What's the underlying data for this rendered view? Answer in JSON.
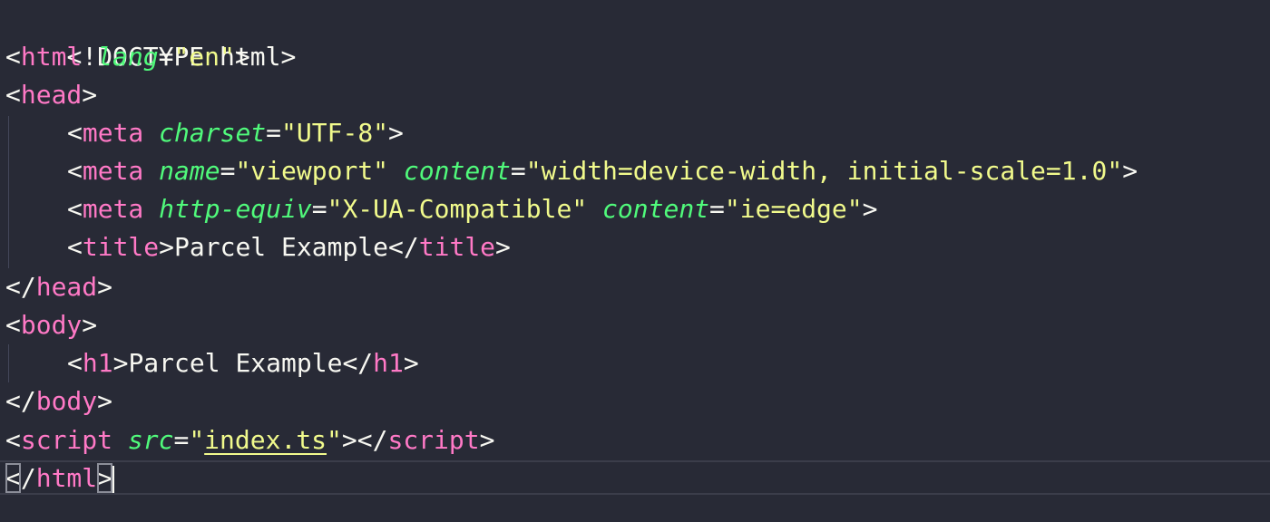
{
  "editor": {
    "lines": [
      {
        "doctype": "<!DOCTYPE html>"
      },
      {
        "open": "<",
        "tag": "html",
        "attr1": "lang",
        "eq": "=",
        "val1": "\"en\"",
        "close": ">"
      },
      {
        "open": "<",
        "tag": "head",
        "close": ">"
      },
      {
        "open": "<",
        "tag": "meta",
        "attr1": "charset",
        "eq": "=",
        "val1": "\"UTF-8\"",
        "close": ">"
      },
      {
        "open": "<",
        "tag": "meta",
        "attr1": "name",
        "eq1": "=",
        "val1": "\"viewport\"",
        "attr2": "content",
        "eq2": "=",
        "val2": "\"width=device-width, initial-scale=1.0\"",
        "close": ">"
      },
      {
        "open": "<",
        "tag": "meta",
        "attr1": "http-equiv",
        "eq1": "=",
        "val1": "\"X-UA-Compatible\"",
        "attr2": "content",
        "eq2": "=",
        "val2": "\"ie=edge\"",
        "close": ">"
      },
      {
        "open": "<",
        "tag": "title",
        "close": ">",
        "text": "Parcel Example",
        "endopen": "</",
        "endtag": "title",
        "endclose": ">"
      },
      {
        "open": "</",
        "tag": "head",
        "close": ">"
      },
      {
        "open": "<",
        "tag": "body",
        "close": ">"
      },
      {
        "open": "<",
        "tag": "h1",
        "close": ">",
        "text": "Parcel Example",
        "endopen": "</",
        "endtag": "h1",
        "endclose": ">"
      },
      {
        "open": "</",
        "tag": "body",
        "close": ">"
      },
      {
        "open": "<",
        "tag": "script",
        "attr1": "src",
        "eq": "=",
        "q1": "\"",
        "val1": "index.ts",
        "q2": "\"",
        "close": ">",
        "endopen": "</",
        "endtag": "script",
        "endclose": ">"
      },
      {
        "open": "<",
        "slash": "/",
        "tag": "html",
        "close": ">"
      }
    ]
  }
}
